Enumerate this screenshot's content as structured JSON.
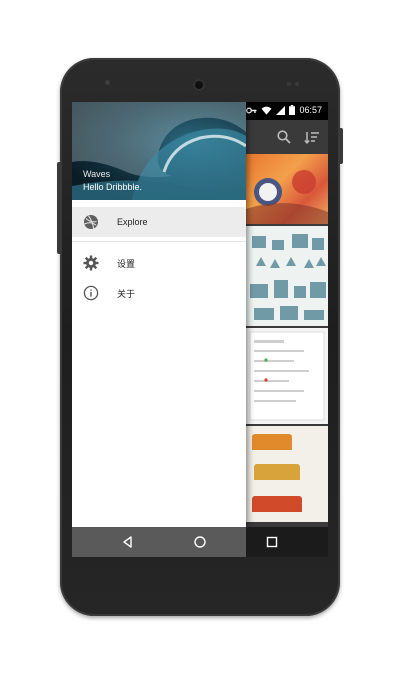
{
  "statusbar": {
    "time": "06:57",
    "icons": [
      "key-icon",
      "wifi-icon",
      "signal-icon",
      "battery-icon"
    ]
  },
  "app": {
    "toolbar_icons": [
      "search-icon",
      "sort-icon"
    ]
  },
  "drawer": {
    "header": {
      "title": "Waves",
      "subtitle": "Hello Dribbble."
    },
    "items": [
      {
        "label": "Explore",
        "icon": "dribbble-icon",
        "active": true
      },
      {
        "label": "设置",
        "icon": "gear-icon",
        "active": false
      },
      {
        "label": "关于",
        "icon": "info-icon",
        "active": false
      }
    ]
  },
  "navbar": {
    "buttons": [
      "back-icon",
      "home-icon",
      "recents-icon"
    ]
  },
  "colors": {
    "drawer_bg": "#ffffff",
    "active_item_bg": "#ececec",
    "toolbar_bg": "#3a3a3a",
    "statusbar_bg": "#000000"
  }
}
